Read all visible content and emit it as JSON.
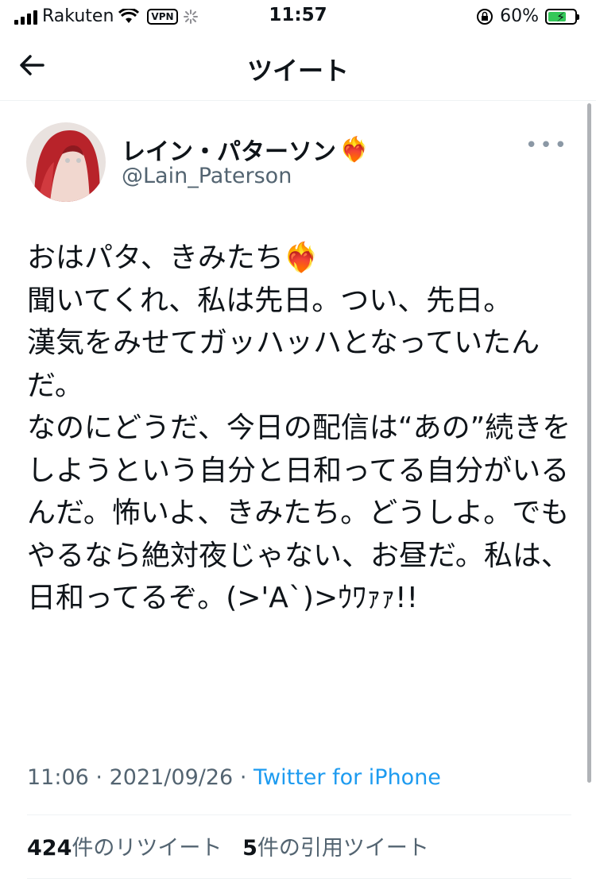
{
  "status_bar": {
    "carrier": "Rakuten",
    "vpn_label": "VPN",
    "time": "11:57",
    "battery_percent": "60%"
  },
  "nav": {
    "back_icon": "arrow-left-icon",
    "title": "ツイート"
  },
  "author": {
    "display_name": "レイン・パターソン",
    "name_emoji": "❤️‍🔥",
    "handle": "@Lain_Paterson"
  },
  "tweet": {
    "text": "おはパタ、きみたち❤️‍🔥\n聞いてくれ、私は先日。つい、先日。\n漢気をみせてガッハッハとなっていたんだ。\nなのにどうだ、今日の配信は“あの”続きをしようという自分と日和ってる自分がいるんだ。怖いよ、きみたち。どうしよ。でもやるなら絶対夜じゃない、お昼だ。私は、日和ってるぞ。(>'A`)>ｳﾜｧｧ!!",
    "time": "11:06",
    "date": "2021/09/26",
    "separator": "·",
    "source": "Twitter for iPhone"
  },
  "stats": {
    "retweets_count": "424",
    "retweets_label": "件のリツイート",
    "quotes_count": "5",
    "quotes_label": "件の引用ツイート"
  },
  "colors": {
    "link": "#1d9bf0",
    "secondary_text": "#536471",
    "battery_fill": "#34c759"
  }
}
